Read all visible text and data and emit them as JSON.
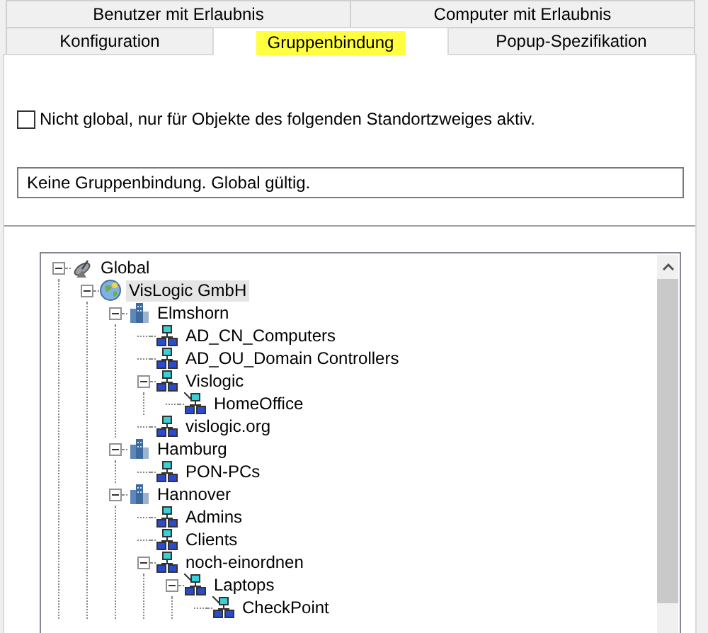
{
  "tab_rows": [
    {
      "tabs": [
        {
          "label": "Benutzer mit Erlaubnis",
          "selected": false,
          "highlighted": false
        },
        {
          "label": "Computer mit Erlaubnis",
          "selected": false,
          "highlighted": false
        }
      ]
    },
    {
      "tabs": [
        {
          "label": "Konfiguration",
          "selected": false,
          "highlighted": false
        },
        {
          "label": "Gruppenbindung",
          "selected": true,
          "highlighted": true
        },
        {
          "label": "Popup-Spezifikation",
          "selected": false,
          "highlighted": false
        }
      ]
    }
  ],
  "scope_checkbox": {
    "label": "Nicht global, nur für Objekte des folgenden Standortzweiges aktiv.",
    "checked": false
  },
  "binding_field": {
    "value": "Keine Gruppenbindung. Global gültig."
  },
  "tree": [
    {
      "label": "Global",
      "kind": "root",
      "selected": false,
      "expanded": true,
      "children": [
        {
          "label": "VisLogic GmbH",
          "kind": "company",
          "selected": true,
          "expanded": true,
          "children": [
            {
              "label": "Elmshorn",
              "kind": "site",
              "selected": false,
              "expanded": true,
              "children": [
                {
                  "label": "AD_CN_Computers",
                  "kind": "group",
                  "selected": false
                },
                {
                  "label": "AD_OU_Domain Controllers",
                  "kind": "group",
                  "selected": false
                },
                {
                  "label": "Vislogic",
                  "kind": "group",
                  "selected": false,
                  "expanded": true,
                  "children": [
                    {
                      "label": "HomeOffice",
                      "kind": "subgroup",
                      "selected": false
                    }
                  ]
                },
                {
                  "label": "vislogic.org",
                  "kind": "group",
                  "selected": false
                }
              ]
            },
            {
              "label": "Hamburg",
              "kind": "site",
              "selected": false,
              "expanded": true,
              "children": [
                {
                  "label": "PON-PCs",
                  "kind": "group",
                  "selected": false
                }
              ]
            },
            {
              "label": "Hannover",
              "kind": "site",
              "selected": false,
              "expanded": true,
              "children": [
                {
                  "label": "Admins",
                  "kind": "group",
                  "selected": false
                },
                {
                  "label": "Clients",
                  "kind": "group",
                  "selected": false
                },
                {
                  "label": "noch-einordnen",
                  "kind": "group",
                  "selected": false,
                  "expanded": true,
                  "children": [
                    {
                      "label": "Laptops",
                      "kind": "subgroup",
                      "selected": false,
                      "expanded": true,
                      "children": [
                        {
                          "label": "CheckPoint",
                          "kind": "subgroup",
                          "selected": false
                        }
                      ]
                    }
                  ]
                }
              ]
            }
          ]
        }
      ]
    }
  ]
}
